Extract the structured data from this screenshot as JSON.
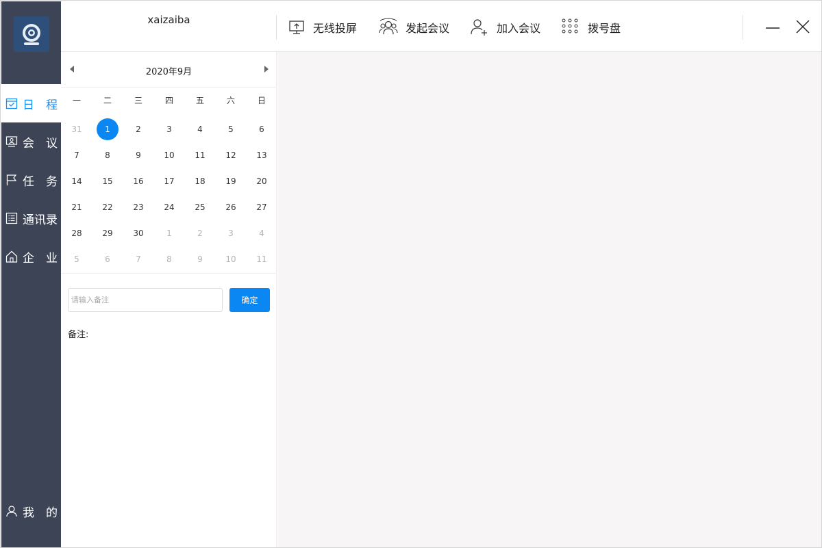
{
  "user": {
    "name": "xaizaiba"
  },
  "sidebar": {
    "items": [
      {
        "label": "日　程",
        "icon": "calendar-check-icon",
        "active": true
      },
      {
        "label": "会　议",
        "icon": "meeting-icon",
        "active": false
      },
      {
        "label": "任　务",
        "icon": "flag-icon",
        "active": false
      },
      {
        "label": "通讯录",
        "icon": "contacts-list-icon",
        "active": false
      },
      {
        "label": "企　业",
        "icon": "home-icon",
        "active": false
      }
    ],
    "bottom": {
      "label": "我　的",
      "icon": "user-icon"
    }
  },
  "toolbar": {
    "wireless": "无线投屏",
    "start_meeting": "发起会议",
    "join_meeting": "加入会议",
    "dialpad": "拨号盘"
  },
  "calendar": {
    "title": "2020年9月",
    "weekdays": [
      "一",
      "二",
      "三",
      "四",
      "五",
      "六",
      "日"
    ],
    "weeks": [
      [
        "31",
        "1",
        "2",
        "3",
        "4",
        "5",
        "6"
      ],
      [
        "7",
        "8",
        "9",
        "10",
        "11",
        "12",
        "13"
      ],
      [
        "14",
        "15",
        "16",
        "17",
        "18",
        "19",
        "20"
      ],
      [
        "21",
        "22",
        "23",
        "24",
        "25",
        "26",
        "27"
      ],
      [
        "28",
        "29",
        "30",
        "1",
        "2",
        "3",
        "4"
      ],
      [
        "5",
        "6",
        "7",
        "8",
        "9",
        "10",
        "11"
      ]
    ],
    "selected": "1"
  },
  "note": {
    "placeholder": "请输入备注",
    "value": "",
    "confirm_label": "确定",
    "label": "备注:"
  },
  "colors": {
    "sidebar_bg": "#3c4455",
    "accent": "#0a87f2",
    "content_bg": "#f7f5f5"
  }
}
